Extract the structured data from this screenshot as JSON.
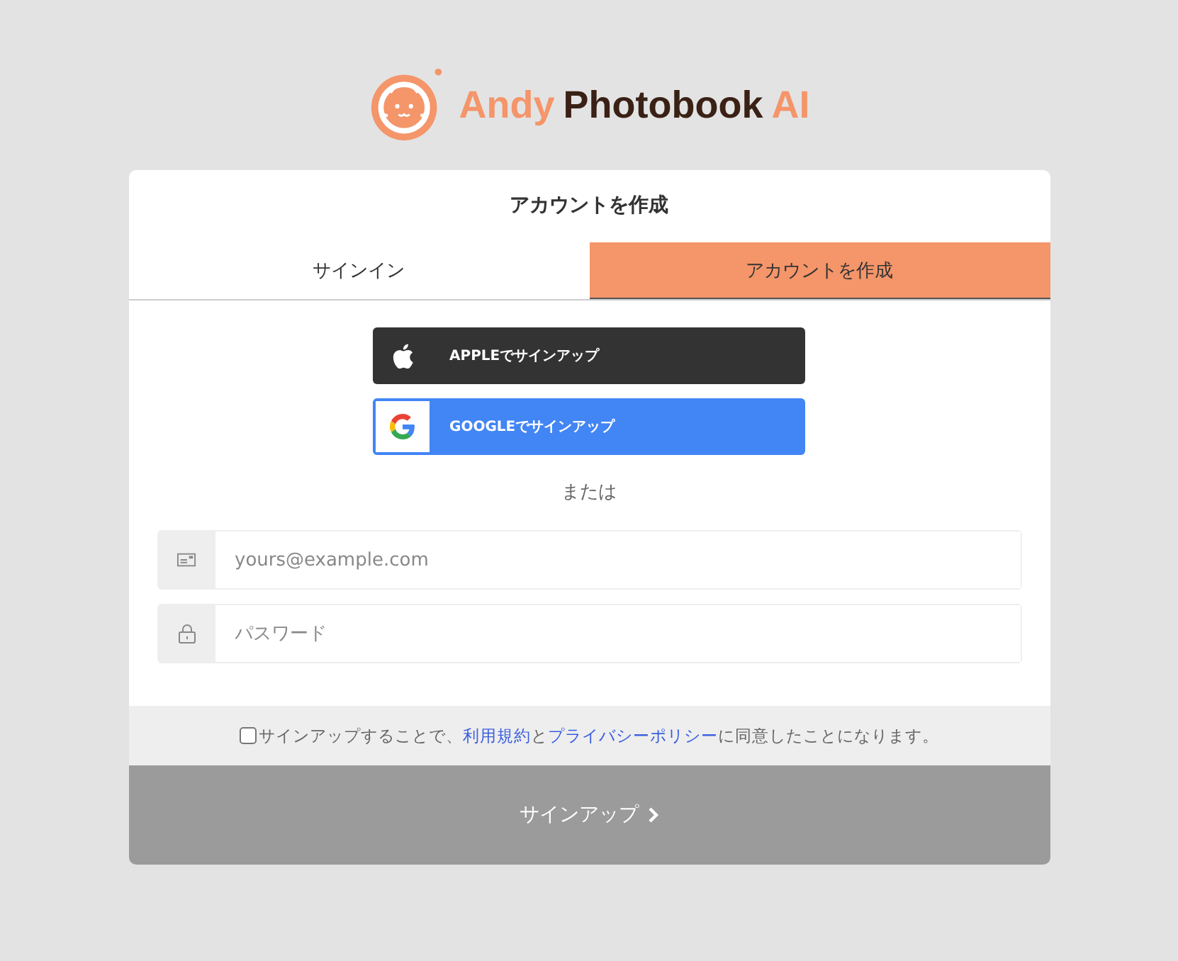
{
  "logo": {
    "parts": [
      {
        "text": "Andy",
        "kind": "accent"
      },
      {
        "text": "Photobook",
        "kind": "dark"
      },
      {
        "text": "AI",
        "kind": "accent"
      }
    ]
  },
  "card": {
    "title": "アカウントを作成"
  },
  "tabs": [
    {
      "label": "サインイン",
      "selected": false
    },
    {
      "label": "アカウントを作成",
      "selected": true
    }
  ],
  "social_buttons": [
    {
      "kind": "apple",
      "label": "APPLEでサインアップ"
    },
    {
      "kind": "google",
      "label": "GOOGLEでサインアップ"
    }
  ],
  "separator": "または",
  "fields": [
    {
      "kind": "email",
      "placeholder": "yours@example.com"
    },
    {
      "kind": "password",
      "placeholder": "パスワード"
    }
  ],
  "terms": {
    "checked": false,
    "before": "サインアップすることで、",
    "link_1": "利用規約",
    "middle": "と",
    "link_2": "プライバシーポリシー",
    "after": "に同意したことになります。"
  },
  "submit": {
    "label": "サインアップ"
  }
}
